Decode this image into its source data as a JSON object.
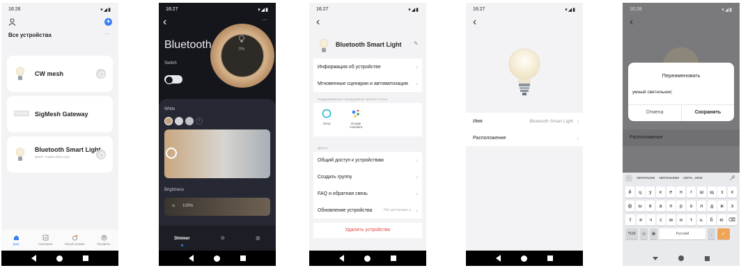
{
  "colors": {
    "accent": "#3a7ff5",
    "danger": "#e2463f",
    "dark_bg": "#15161c",
    "panel": "#262833",
    "orange": "#ef6c35"
  },
  "screen1": {
    "time": "16:26",
    "title": "Все устройства",
    "more": "···",
    "devices": [
      {
        "name": "CW mesh"
      },
      {
        "name": "SigMesh Gateway"
      },
      {
        "name": "Bluetooth Smart Light",
        "status": "⊕OFF ☀100% ⅠⅠ0% 0:0s"
      }
    ],
    "tabs": [
      "Дом",
      "Сценарии",
      "Умный режим",
      "Профиль"
    ]
  },
  "screen2": {
    "time": "16:27",
    "more": "···",
    "title": "Bluetooth S...",
    "ring_value": "0%",
    "switch_label": "Switch",
    "white_label": "White",
    "brightness_label": "Brightness",
    "brightness_value": "100%",
    "tabs": {
      "dimmer": "Dimmer"
    }
  },
  "screen3": {
    "time": "16:27",
    "title": "Bluetooth Smart Light",
    "rows": [
      "Информация об устройстве",
      "Мгновенные сценарии и автоматизация"
    ],
    "third_party_caption": "Поддерживаемое оборудование третьих сторон",
    "assistants": [
      {
        "name": "Alexa"
      },
      {
        "name": "Google Assistant"
      }
    ],
    "other_caption": "Другое",
    "other_rows": [
      "Общий доступ к устройствам",
      "Создать группу",
      "FAQ и обратная связь"
    ],
    "update_row": {
      "label": "Обновление устройства",
      "value": "Нет доступных о..."
    },
    "delete_label": "Удалить устройство"
  },
  "screen4": {
    "time": "16:27",
    "name_label": "Имя",
    "name_value": "Bluetooth Smart Light",
    "location_label": "Расположение"
  },
  "screen5": {
    "time": "16:28",
    "dialog_title": "Переименовать",
    "input_value": "умный светильник",
    "cancel_label": "Отмена",
    "save_label": "Сохранить",
    "location_label": "Расположение",
    "suggestions": [
      "светильник",
      "светильники",
      "свети...иков"
    ],
    "keyboard_rows": [
      [
        "й",
        "ц",
        "у",
        "к",
        "е",
        "н",
        "г",
        "ш",
        "щ",
        "з",
        "х"
      ],
      [
        "ф",
        "ы",
        "в",
        "а",
        "п",
        "р",
        "о",
        "л",
        "д",
        "ж",
        "э"
      ],
      [
        "я",
        "ч",
        "с",
        "м",
        "и",
        "т",
        "ь",
        "б",
        "ю"
      ]
    ],
    "num_key": "?123",
    "lang_key": "Русский"
  }
}
